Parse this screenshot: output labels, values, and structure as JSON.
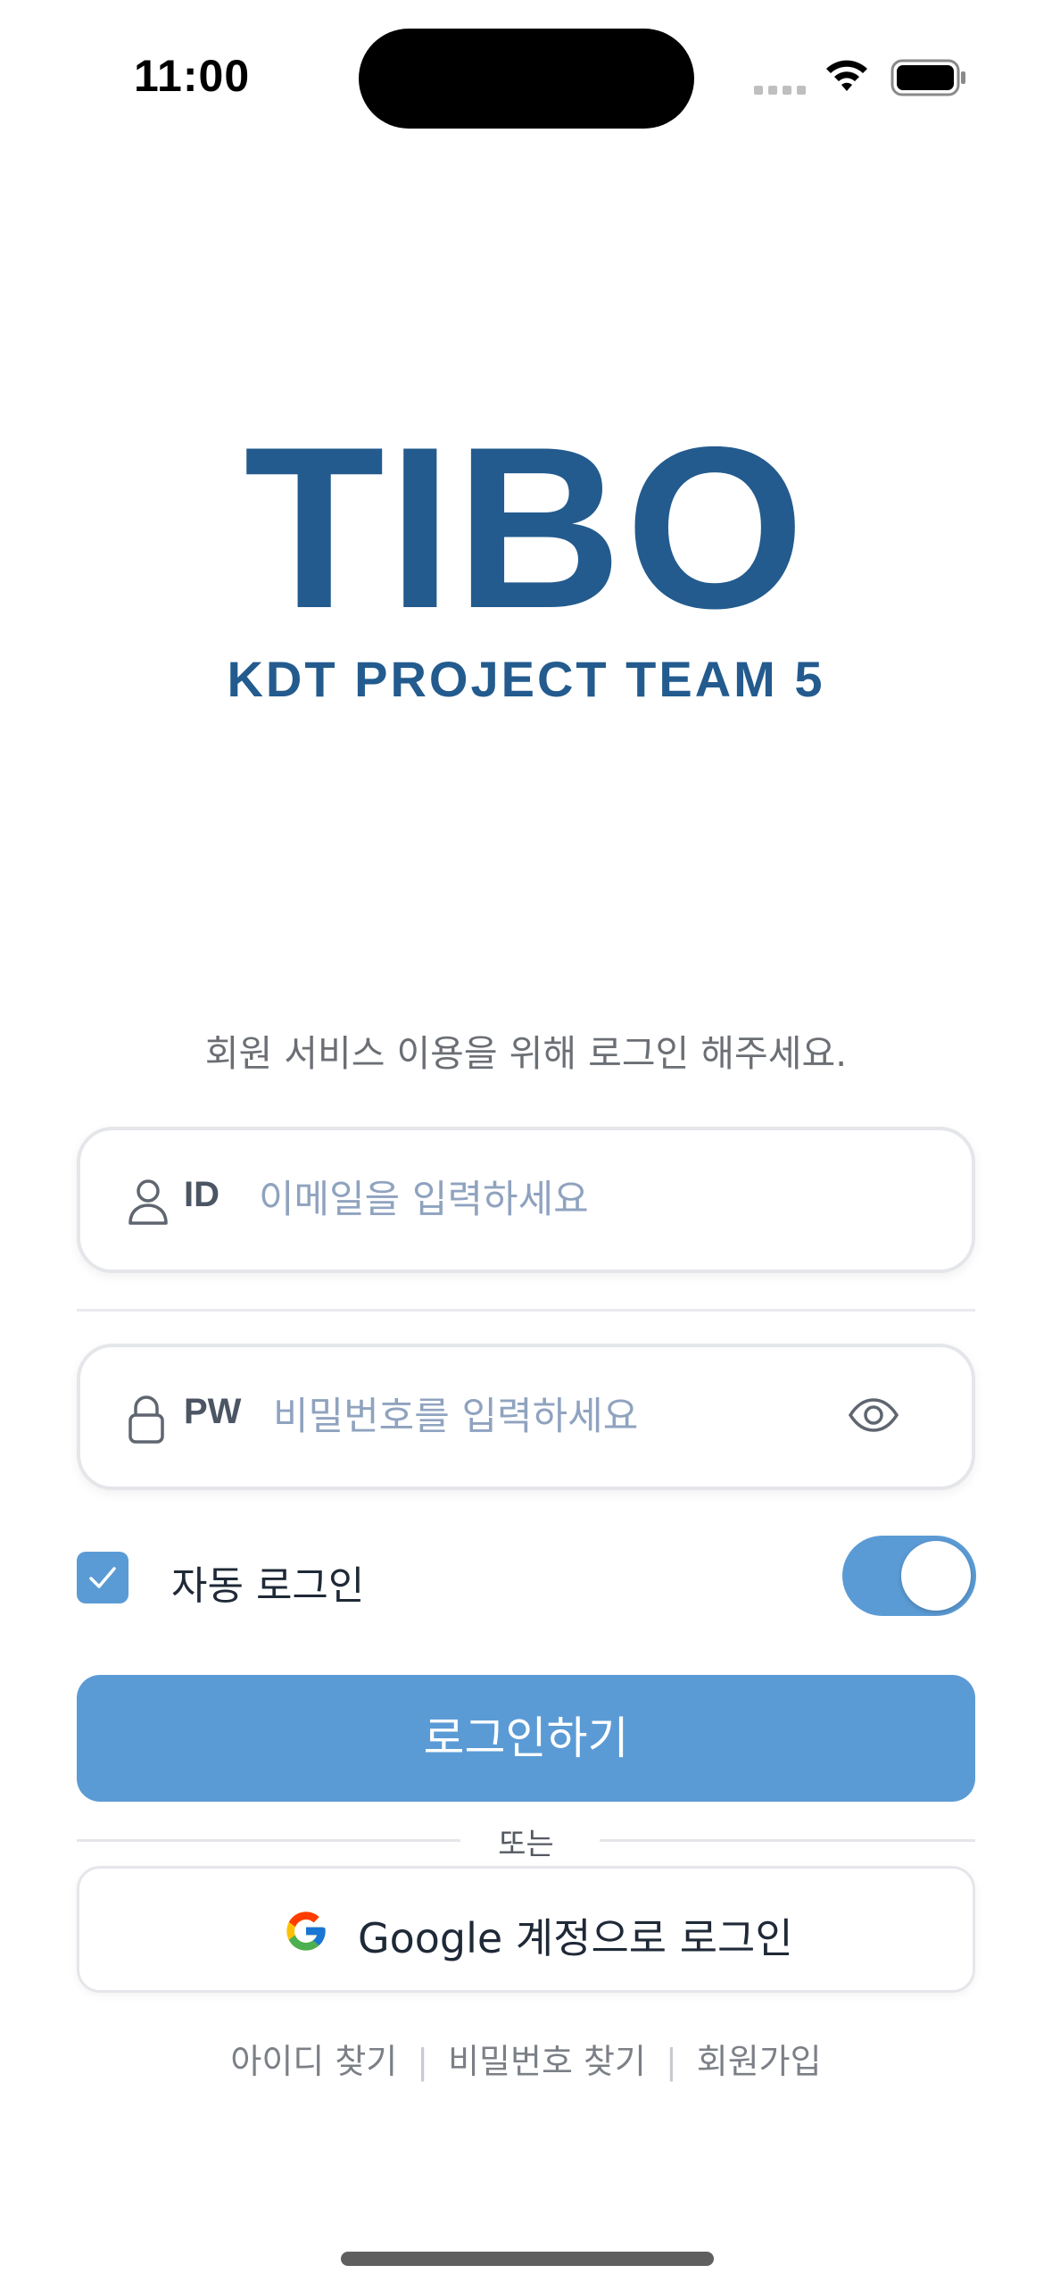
{
  "status_bar": {
    "time": "11:00"
  },
  "brand": {
    "logo": "TIBO",
    "subtitle": "KDT PROJECT TEAM 5"
  },
  "login": {
    "prompt": "회원 서비스 이용을 위해 로그인 해주세요.",
    "id_label": "ID",
    "id_placeholder": "이메일을 입력하세요",
    "pw_label": "PW",
    "pw_placeholder": "비밀번호를 입력하세요",
    "auto_login_label": "자동 로그인",
    "auto_login_checked": true,
    "auto_login_toggle_on": true,
    "submit_label": "로그인하기",
    "or_label": "또는",
    "google_label": "Google 계정으로 로그인"
  },
  "links": [
    "아이디 찾기",
    "비밀번호 찾기",
    "회원가입"
  ],
  "colors": {
    "brand": "#235b8e",
    "accent": "#5b9bd5",
    "placeholder": "#8fa3bf"
  },
  "icons": [
    "wifi-icon",
    "battery-icon",
    "user-icon",
    "lock-icon",
    "eye-icon",
    "check-icon",
    "google-icon"
  ]
}
